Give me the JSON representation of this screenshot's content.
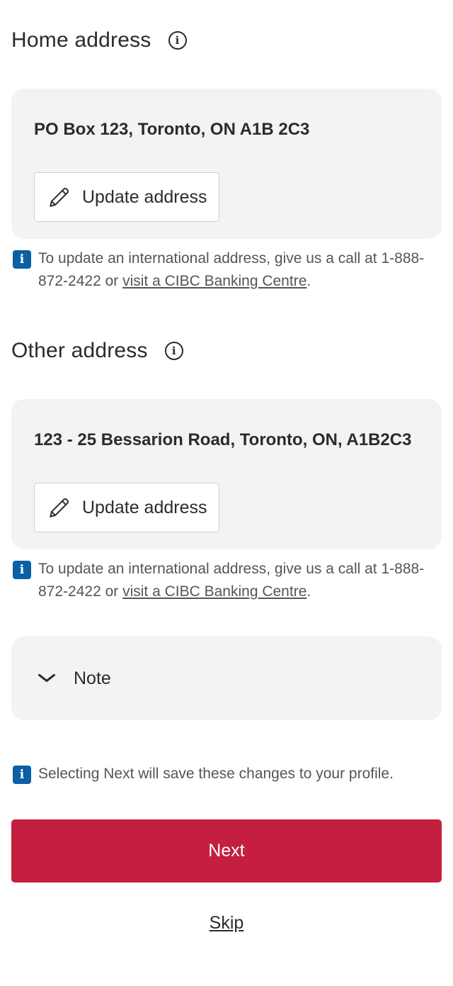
{
  "home": {
    "title": "Home address",
    "address": "PO Box 123, Toronto, ON A1B 2C3",
    "update_label": "Update address",
    "note_text": "To update an international address, give us a call at 1-888-872-2422 or ",
    "note_link": "visit a CIBC Banking Centre",
    "note_end": "."
  },
  "other": {
    "title": "Other address",
    "address": "123 - 25 Bessarion Road, Toronto, ON, A1B2C3",
    "update_label": "Update address",
    "note_text": "To update an international address, give us a call at 1-888-872-2422 or ",
    "note_link": "visit a CIBC Banking Centre",
    "note_end": "."
  },
  "note_section": {
    "label": "Note"
  },
  "save_notice": "Selecting Next will save these changes to your profile.",
  "actions": {
    "next_label": "Next",
    "skip_label": "Skip"
  },
  "icons": {
    "info_circle": "info-circle-icon",
    "info_badge": "info-badge-icon",
    "pencil": "pencil-icon",
    "chevron": "chevron-down-icon"
  },
  "colors": {
    "primary": "#c41f3e",
    "info": "#0b5fa5",
    "card_bg": "#f3f3f3"
  }
}
